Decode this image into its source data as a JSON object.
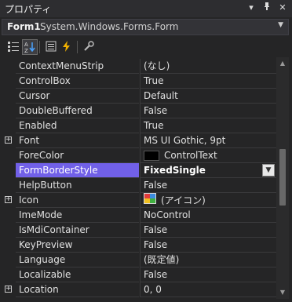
{
  "window": {
    "title": "プロパティ"
  },
  "object_selector": {
    "name": "Form1",
    "type": "System.Windows.Forms.Form"
  },
  "toolbar": {
    "buttons": [
      "categorized-icon",
      "alphabetical-icon",
      "properties-icon",
      "events-icon",
      "property-pages-icon"
    ]
  },
  "properties": [
    {
      "name": "ContextMenuStrip",
      "value": "(なし)"
    },
    {
      "name": "ControlBox",
      "value": "True"
    },
    {
      "name": "Cursor",
      "value": "Default"
    },
    {
      "name": "DoubleBuffered",
      "value": "False"
    },
    {
      "name": "Enabled",
      "value": "True"
    },
    {
      "name": "Font",
      "value": "MS UI Gothic, 9pt",
      "expandable": true
    },
    {
      "name": "ForeColor",
      "value": "ControlText",
      "swatch": "#000000"
    },
    {
      "name": "FormBorderStyle",
      "value": "FixedSingle",
      "selected": true
    },
    {
      "name": "HelpButton",
      "value": "False"
    },
    {
      "name": "Icon",
      "value": "(アイコン)",
      "expandable": true,
      "icon": true
    },
    {
      "name": "ImeMode",
      "value": "NoControl"
    },
    {
      "name": "IsMdiContainer",
      "value": "False"
    },
    {
      "name": "KeyPreview",
      "value": "False"
    },
    {
      "name": "Language",
      "value": "(既定値)"
    },
    {
      "name": "Localizable",
      "value": "False"
    },
    {
      "name": "Location",
      "value": "0, 0",
      "expandable": true
    }
  ],
  "colors": {
    "selection": "#7160e8",
    "background": "#252526"
  }
}
